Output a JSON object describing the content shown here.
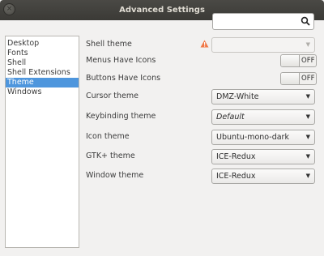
{
  "window": {
    "title": "Advanced Settings",
    "close_glyph": "×"
  },
  "search": {
    "value": "",
    "icon": "search-icon"
  },
  "sidebar": {
    "items": [
      {
        "label": "Desktop"
      },
      {
        "label": "Fonts"
      },
      {
        "label": "Shell"
      },
      {
        "label": "Shell Extensions"
      },
      {
        "label": "Theme",
        "selected": true
      },
      {
        "label": "Windows"
      }
    ]
  },
  "settings": {
    "shell_theme": {
      "label": "Shell theme",
      "value": "",
      "warning_icon": "warning-icon"
    },
    "menus_have_icons": {
      "label": "Menus Have Icons",
      "state": "OFF"
    },
    "buttons_have_icons": {
      "label": "Buttons Have Icons",
      "state": "OFF"
    },
    "cursor_theme": {
      "label": "Cursor theme",
      "value": "DMZ-White"
    },
    "keybinding_theme": {
      "label": "Keybinding theme",
      "value": "Default"
    },
    "icon_theme": {
      "label": "Icon theme",
      "value": "Ubuntu-mono-dark"
    },
    "gtk_theme": {
      "label": "GTK+ theme",
      "value": "ICE-Redux"
    },
    "window_theme": {
      "label": "Window theme",
      "value": "ICE-Redux"
    }
  },
  "colors": {
    "selection": "#4e96dd",
    "titlebar": "#3c3b37",
    "warning": "#f07746"
  }
}
